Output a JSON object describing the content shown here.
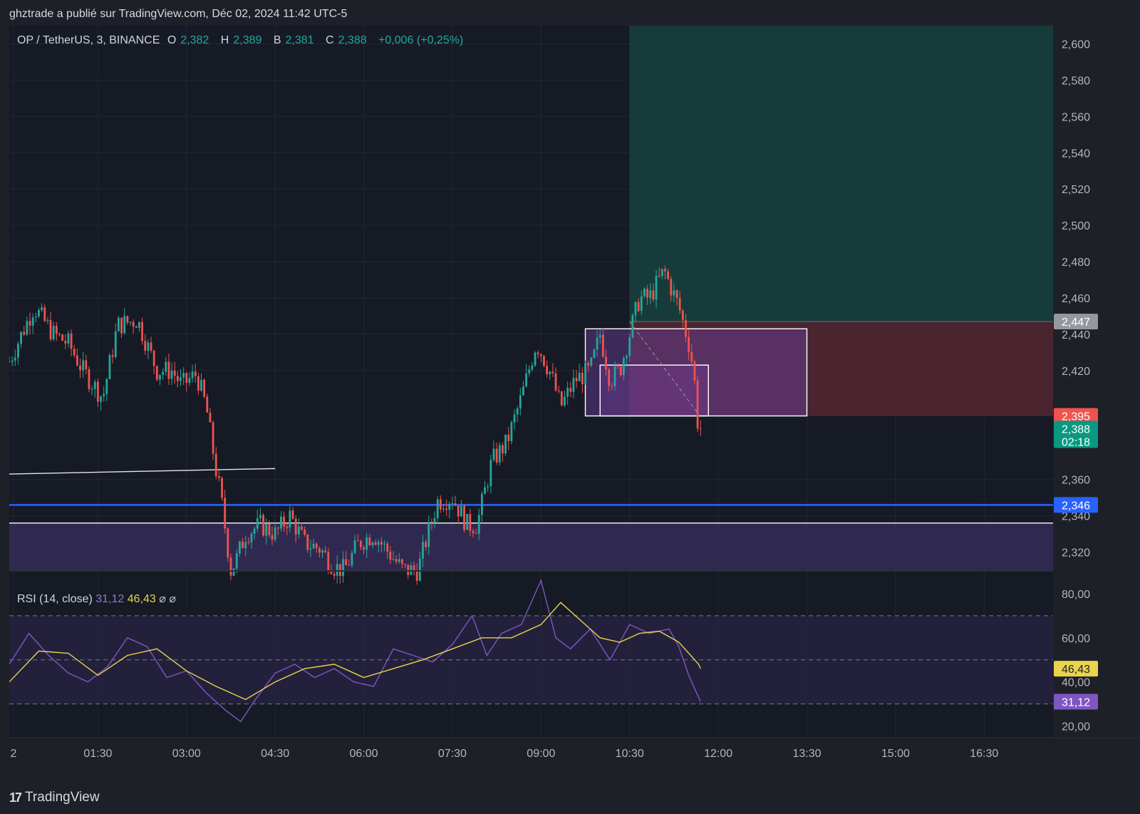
{
  "header": {
    "caption": "ghztrade a publié sur TradingView.com, Déc 02, 2024 11:42 UTC-5"
  },
  "legend": {
    "symbol": "OP / TetherUS, 3, BINANCE",
    "o_label": "O",
    "o_value": "2,382",
    "h_label": "H",
    "h_value": "2,389",
    "b_label": "B",
    "b_value": "2,381",
    "c_label": "C",
    "c_value": "2,388",
    "change": "+0,006 (+0,25%)"
  },
  "rsi_legend": {
    "label": "RSI (14, close)",
    "rsi_value": "31,12",
    "ma_value": "46,43",
    "icon1": "⌀",
    "icon2": "⌀"
  },
  "brand": {
    "logo": "17",
    "name": "TradingView"
  },
  "colors": {
    "background": "#1e2028",
    "plot_bg": "#161a25",
    "up": "#26a69a",
    "down": "#ef5350",
    "blue_line": "#2962ff",
    "rsi_line": "#7e57c2",
    "rsi_ma": "#e9d44b",
    "profit_zone": "#173b3a",
    "loss_zone": "#4a2530",
    "zone_purple": "#3a2f5e"
  },
  "chart_data": [
    {
      "type": "candlestick",
      "title": "OP / TetherUS, 3, BINANCE",
      "ylim": [
        2.31,
        2.61
      ],
      "yticks": [
        "2,600",
        "2,580",
        "2,560",
        "2,540",
        "2,520",
        "2,500",
        "2,480",
        "2,460",
        "2,440",
        "2,420",
        "2,360",
        "2,340",
        "2,320"
      ],
      "xticks": [
        "2",
        "01:30",
        "03:00",
        "04:30",
        "06:00",
        "07:30",
        "09:00",
        "10:30",
        "12:00",
        "13:30",
        "15:00",
        "16:30"
      ],
      "price_path": {
        "times": [
          "00:00",
          "00:25",
          "00:45",
          "01:00",
          "01:15",
          "01:35",
          "01:50",
          "02:10",
          "02:30",
          "02:45",
          "02:55",
          "03:10",
          "03:20",
          "03:30",
          "03:35",
          "03:45",
          "03:50",
          "04:00",
          "04:15",
          "04:30",
          "04:45",
          "05:00",
          "05:15",
          "05:30",
          "05:40",
          "05:55",
          "06:10",
          "06:25",
          "06:40",
          "06:55",
          "07:05",
          "07:15",
          "07:30",
          "07:45",
          "07:55",
          "08:10",
          "08:25",
          "08:40",
          "08:55",
          "09:00",
          "09:10",
          "09:20",
          "09:35",
          "09:50",
          "10:00",
          "10:10",
          "10:20",
          "10:30",
          "10:40",
          "10:50",
          "11:05",
          "11:20",
          "11:30",
          "11:35",
          "11:40",
          "11:42"
        ],
        "close": [
          2.425,
          2.455,
          2.44,
          2.435,
          2.42,
          2.405,
          2.445,
          2.448,
          2.42,
          2.42,
          2.412,
          2.418,
          2.4,
          2.365,
          2.35,
          2.31,
          2.315,
          2.33,
          2.335,
          2.33,
          2.34,
          2.325,
          2.322,
          2.312,
          2.31,
          2.325,
          2.33,
          2.32,
          2.31,
          2.31,
          2.33,
          2.348,
          2.35,
          2.335,
          2.335,
          2.37,
          2.38,
          2.405,
          2.435,
          2.43,
          2.418,
          2.4,
          2.415,
          2.42,
          2.44,
          2.415,
          2.42,
          2.44,
          2.46,
          2.46,
          2.475,
          2.455,
          2.435,
          2.42,
          2.385,
          2.388
        ]
      },
      "price_labels": [
        {
          "value": 2.447,
          "text": "2,447",
          "color": "#9598a1"
        },
        {
          "value": 2.395,
          "text": "2,395",
          "color": "#ef5350"
        },
        {
          "value": 2.388,
          "text": "2,388",
          "sub": "02:18",
          "color": "#089981"
        },
        {
          "value": 2.346,
          "text": "2,346",
          "color": "#2962ff"
        }
      ],
      "drawings": {
        "horizontal_line": 2.346,
        "white_line": 2.336,
        "trend_line": {
          "from": [
            "00:00",
            2.363
          ],
          "to": [
            "04:30",
            2.366
          ]
        },
        "support_zone": {
          "from_time": "00:00",
          "to_time": "17:40",
          "top": 2.336,
          "bottom": 2.31
        },
        "position": {
          "start_time": "10:30",
          "end_time": "17:40",
          "entry": 2.447,
          "target": 2.61,
          "stop": 2.395
        },
        "box_outer": {
          "from": "09:45",
          "to": "13:30",
          "top": 2.443,
          "bottom": 2.395
        },
        "box_inner": {
          "from": "10:00",
          "to": "11:50",
          "top": 2.423,
          "bottom": 2.395
        }
      }
    },
    {
      "type": "line",
      "title": "RSI (14, close)",
      "ylim": [
        15,
        90
      ],
      "yticks": [
        "80,00",
        "60,00",
        "40,00",
        "20,00"
      ],
      "bands": [
        30,
        50,
        70
      ],
      "series": [
        {
          "name": "RSI",
          "times": [
            "00:00",
            "00:20",
            "00:40",
            "01:00",
            "01:20",
            "01:40",
            "02:00",
            "02:20",
            "02:40",
            "03:00",
            "03:20",
            "03:40",
            "03:55",
            "04:10",
            "04:30",
            "04:50",
            "05:10",
            "05:30",
            "05:50",
            "06:10",
            "06:30",
            "06:50",
            "07:10",
            "07:30",
            "07:50",
            "08:05",
            "08:20",
            "08:40",
            "09:00",
            "09:15",
            "09:30",
            "09:50",
            "10:10",
            "10:30",
            "10:50",
            "11:10",
            "11:20",
            "11:30",
            "11:40",
            "11:42"
          ],
          "values": [
            48,
            62,
            52,
            44,
            40,
            47,
            60,
            56,
            42,
            45,
            35,
            27,
            22,
            32,
            44,
            48,
            42,
            46,
            40,
            38,
            55,
            52,
            49,
            57,
            70,
            52,
            62,
            66,
            86,
            60,
            55,
            64,
            50,
            66,
            62,
            64,
            56,
            43,
            33,
            31
          ]
        },
        {
          "name": "RSI MA",
          "times": [
            "00:00",
            "00:30",
            "01:00",
            "01:30",
            "02:00",
            "02:30",
            "03:00",
            "03:30",
            "04:00",
            "04:30",
            "05:00",
            "05:30",
            "06:00",
            "06:30",
            "07:00",
            "07:30",
            "08:00",
            "08:30",
            "09:00",
            "09:20",
            "09:40",
            "10:00",
            "10:20",
            "10:40",
            "11:00",
            "11:20",
            "11:40",
            "11:42"
          ],
          "values": [
            40,
            54,
            53,
            43,
            52,
            55,
            45,
            38,
            32,
            40,
            46,
            48,
            42,
            46,
            50,
            55,
            60,
            60,
            66,
            76,
            68,
            60,
            58,
            62,
            63,
            58,
            48,
            46
          ]
        }
      ]
    }
  ]
}
